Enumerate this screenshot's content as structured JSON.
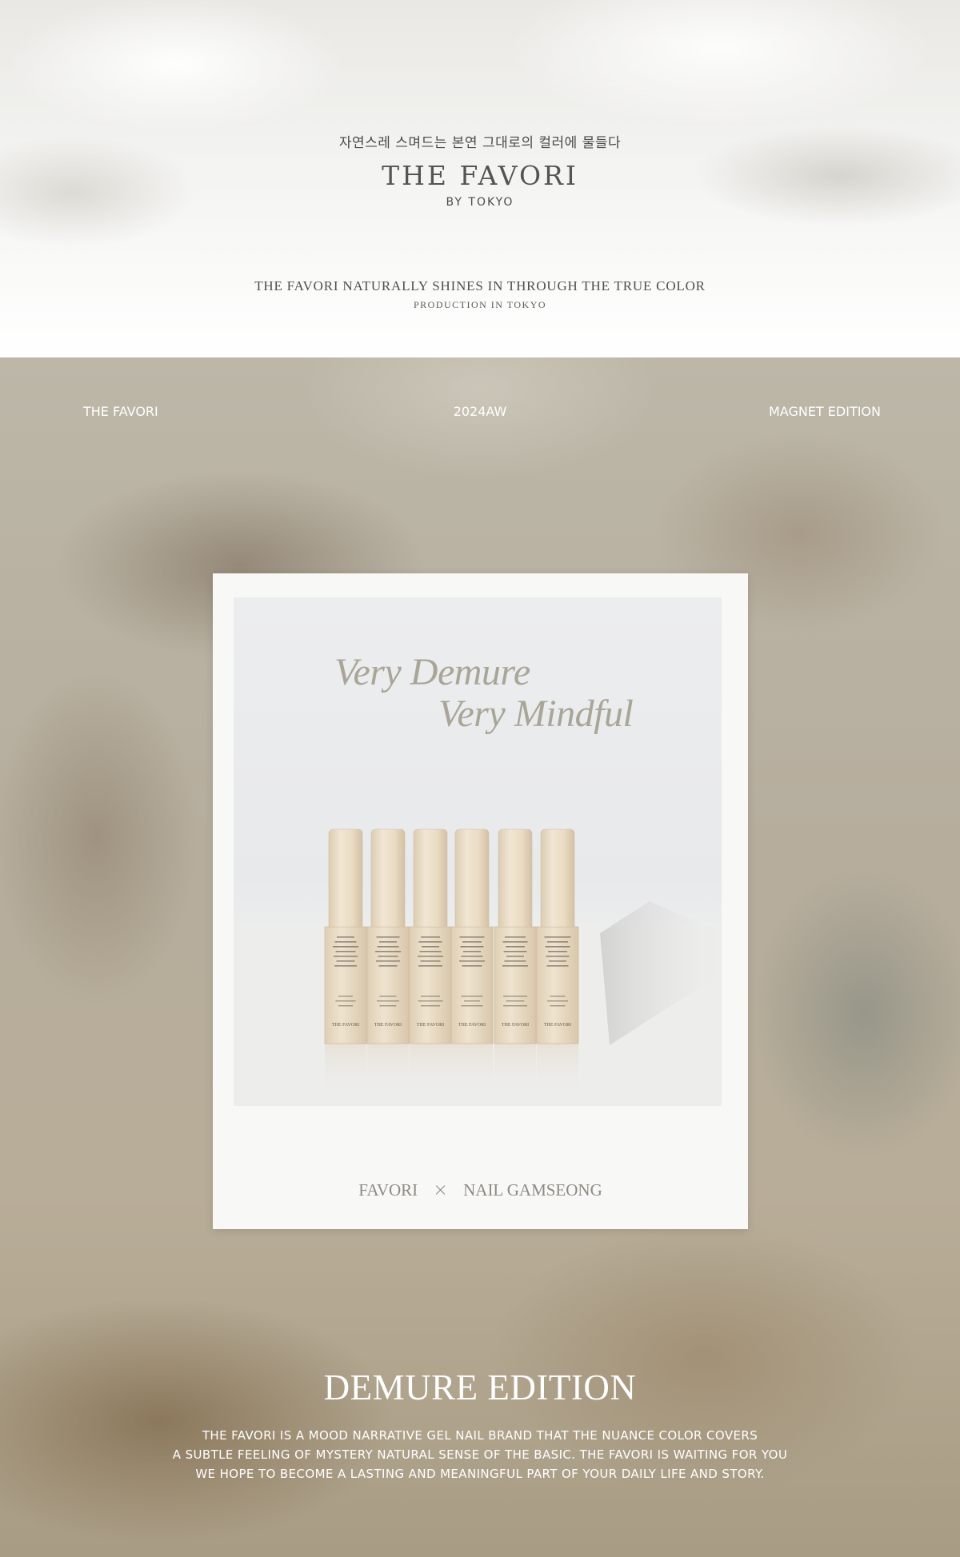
{
  "hero": {
    "subtitle_kr": "자연스레 스며드는 본연 그대로의 컬러에 물들다",
    "brand": "THE FAVORI",
    "brand_sub": "BY TOKYO",
    "tagline": "THE FAVORI NATURALLY SHINES IN THROUGH THE TRUE COLOR",
    "tagline_sub": "PRODUCTION IN TOKYO"
  },
  "meta": {
    "left": "THE FAVORI",
    "center": "2024AW",
    "right": "MAGNET EDITION"
  },
  "card": {
    "headline_1": "Very Demure",
    "headline_2": "Very Mindful",
    "caption_left": "FAVORI",
    "caption_x": "×",
    "caption_right": "NAIL GAMSEONG",
    "bottle_brand": "THE FAVORI"
  },
  "edition": {
    "title": "DEMURE EDITION",
    "lines": [
      "THE FAVORI IS A MOOD NARRATIVE GEL NAIL BRAND THAT THE NUANCE COLOR COVERS",
      "A SUBTLE FEELING OF MYSTERY NATURAL SENSE OF THE BASIC. THE FAVORI IS WAITING FOR YOU",
      "WE HOPE TO BECOME A LASTING AND MEANINGFUL PART OF YOUR DAILY LIFE AND STORY."
    ]
  },
  "colors": {
    "bottle_cap": "#ece0cc",
    "bottle_body": "#ebdcc6",
    "headline": "#a9a597"
  }
}
